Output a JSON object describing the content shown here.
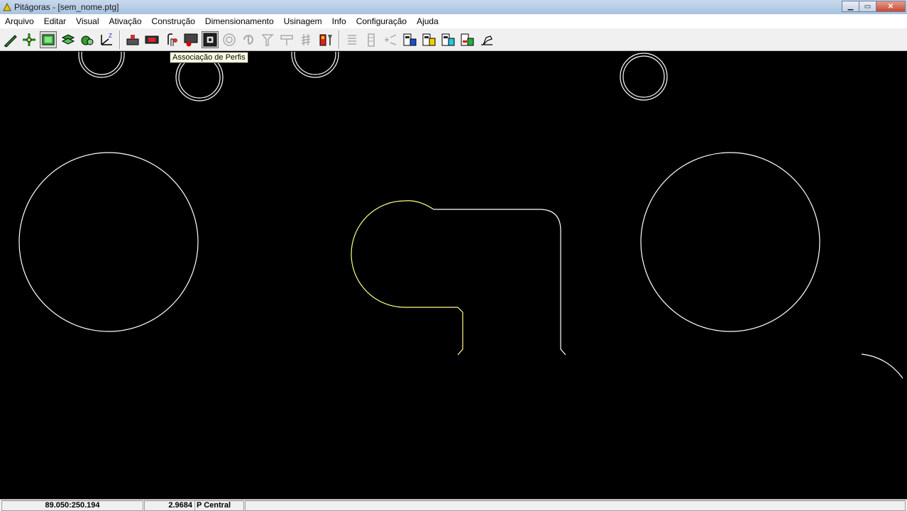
{
  "window": {
    "title": "Pitágoras - [sem_nome.ptg]",
    "minimize_glyph": "▁",
    "maximize_glyph": "▭",
    "close_glyph": "✕"
  },
  "menu": [
    "Arquivo",
    "Editar",
    "Visual",
    "Ativação",
    "Construção",
    "Dimensionamento",
    "Usinagem",
    "Info",
    "Configuração",
    "Ajuda"
  ],
  "toolbar": {
    "icons": [
      "pencil-icon",
      "move-icon",
      "layer-active-icon",
      "layers-icon",
      "gear-group-icon",
      "axes-icon",
      "tool-holder-icon",
      "profile-icon",
      "profile-association-icon",
      "monitor-point-icon",
      "frame-icon",
      "target-icon",
      "rotate-icon",
      "tool-icon",
      "bridge-icon",
      "thread-icon",
      "tool-color-icon",
      "list-icon",
      "sequence-icon",
      "g1-g0-icon",
      "machine-icon",
      "machine-yellow-icon",
      "machine-cyan-icon",
      "machine-green-icon",
      "hand-machine-icon"
    ],
    "tooltip": "Associação de Perfis",
    "axes_label": "Z"
  },
  "colors": {
    "canvas_bg": "#000000",
    "geometry_white": "#ffffff",
    "geometry_yellow": "#ffff80"
  },
  "status": {
    "coords": "89.050:250.194",
    "value": "2.9684",
    "mode": "P Central"
  }
}
